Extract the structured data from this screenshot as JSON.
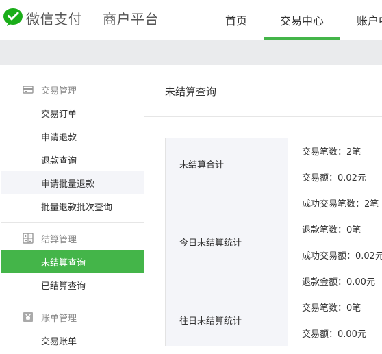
{
  "header": {
    "brand": "微信支付",
    "sub_brand": "商户平台",
    "tabs": [
      {
        "label": "首页"
      },
      {
        "label": "交易中心"
      },
      {
        "label": "账户中"
      }
    ],
    "accent_color": "#44b549"
  },
  "sidebar": {
    "groups": [
      {
        "title": "交易管理",
        "icon": "card-icon",
        "items": [
          {
            "label": "交易订单"
          },
          {
            "label": "申请退款"
          },
          {
            "label": "退款查询"
          },
          {
            "label": "申请批量退款"
          },
          {
            "label": "批量退款批次查询"
          }
        ]
      },
      {
        "title": "结算管理",
        "icon": "calculator-icon",
        "items": [
          {
            "label": "未结算查询"
          },
          {
            "label": "已结算查询"
          }
        ]
      },
      {
        "title": "账单管理",
        "icon": "yen-icon",
        "items": [
          {
            "label": "交易账单"
          }
        ]
      }
    ],
    "active_item": "未结算查询",
    "hovered_item": "申请批量退款"
  },
  "main": {
    "title": "未结算查询",
    "sections": [
      {
        "category": "未结算合计",
        "rows": [
          "交易笔数：2笔",
          "交易额：0.02元"
        ]
      },
      {
        "category": "今日未结算统计",
        "rows": [
          "成功交易笔数：2笔",
          "退款笔数：0笔",
          "成功交易额：0.02元",
          "退款金额：0.00元"
        ]
      },
      {
        "category": "往日未结算统计",
        "rows": [
          "交易笔数：0笔",
          "交易额：0.00元"
        ]
      }
    ]
  }
}
